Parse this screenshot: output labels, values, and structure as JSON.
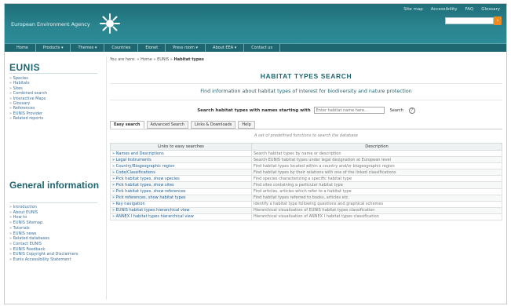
{
  "banner": {
    "agency": "European Environment Agency",
    "links": [
      "Site map",
      "Accessibility",
      "FAQ",
      "Glossary"
    ],
    "search_go": "›"
  },
  "nav": [
    "Home",
    "Products ▾",
    "Themes ▾",
    "Countries",
    "Eionet",
    "Press room ▾",
    "About EEA ▾",
    "Contact us"
  ],
  "sidebar": {
    "eunis_title": "EUNIS",
    "eunis_items": [
      "Species",
      "Habitats",
      "Sites",
      "Combined search",
      "Interactive Maps",
      "Glossary",
      "References",
      "EUNIS Provider",
      "Related reports"
    ],
    "general_title": "General information",
    "general_items": [
      "Introduction",
      "About EUNIS",
      "How to",
      "EUNIS Sitemap",
      "Tutorials",
      "EUNIS news",
      "Related databases",
      "Contact EUNIS",
      "EUNIS Feedback",
      "EUNIS Copyright and Disclaimers",
      "Eunis Accessibility Statement"
    ]
  },
  "main": {
    "breadcrumb_prefix": "You are here: » Home » EUNIS » ",
    "breadcrumb_current": "Habitat types",
    "title": "HABITAT TYPES SEARCH",
    "subtitle": "Find information about habitat types of interest for biodiversity and nature protection",
    "search_label": "Search habitat types with names starting with",
    "search_placeholder": "Enter habitat name here...",
    "search_button": "Search",
    "help": "?",
    "tabs": [
      "Easy search",
      "Advanced Search",
      "Links & Downloads",
      "Help"
    ],
    "table_note": "A set of predefined functions to search the database",
    "table_headers": [
      "Links to easy searches",
      "Description"
    ],
    "rows": [
      {
        "link": "Names and Descriptions",
        "desc": "Search habitat types by name or description"
      },
      {
        "link": "Legal Instruments",
        "desc": "Search EUNIS habitat types under legal designation at European level"
      },
      {
        "link": "Country/Biogeographic region",
        "desc": "Find habitat types located within a country and/or biogeographic region"
      },
      {
        "link": "Code/Classifications",
        "desc": "Find habitat types by their relations with one of the linked classifications"
      },
      {
        "link": "Pick habitat types, show species",
        "desc": "Find species characterizing a specific habitat type"
      },
      {
        "link": "Pick habitat types, show sites",
        "desc": "Find sites containing a particular habitat type"
      },
      {
        "link": "Pick habitat types, show references",
        "desc": "Find articles, articles which refer to a habitat type"
      },
      {
        "link": "Pick references, show habitat types",
        "desc": "Find habitat types referred to books, articles etc."
      },
      {
        "link": "Key navigation",
        "desc": "Identify a habitat type following questions and graphical schemes"
      },
      {
        "link": "EUNIS habitat types hierarchical view",
        "desc": "Hierarchical visualisation of EUNIS habitat types classification"
      },
      {
        "link": "ANNEX I habitat types hierarchical view",
        "desc": "Hierarchical visualisation of ANNEX I habitat types classification"
      }
    ]
  },
  "colors": {
    "accent": "#1e6670",
    "banner": "#2a8590",
    "link": "#1a5d97",
    "go_button": "#f08a1c"
  }
}
